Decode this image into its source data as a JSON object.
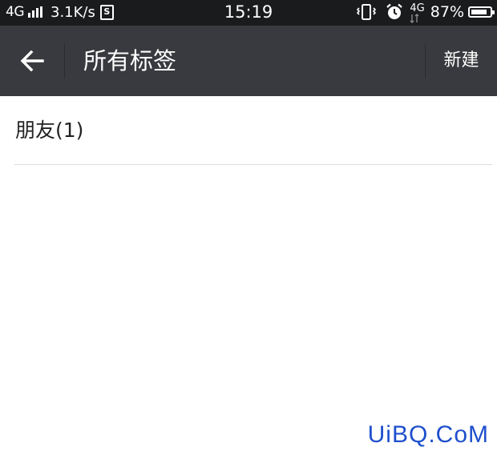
{
  "status_bar": {
    "network": "4G",
    "speed": "3.1K/s",
    "sim_icon_label": "S",
    "time": "15:19",
    "network_right": "4G",
    "battery_percent": "87%",
    "battery_level": 0.87,
    "icons": [
      "signal-icon",
      "sim-icon",
      "vibrate-icon",
      "alarm-icon",
      "data-arrows-icon",
      "battery-icon"
    ]
  },
  "app_bar": {
    "back_icon": "back-arrow-icon",
    "title": "所有标签",
    "new_label": "新建"
  },
  "tags": [
    {
      "label": "朋友(1)"
    }
  ],
  "watermark": "UiBQ.CoM",
  "colors": {
    "status_bar_bg": "#1a1b1d",
    "app_bar_bg": "#393a3f",
    "content_bg": "#ffffff",
    "watermark": "#1e4fcc"
  }
}
